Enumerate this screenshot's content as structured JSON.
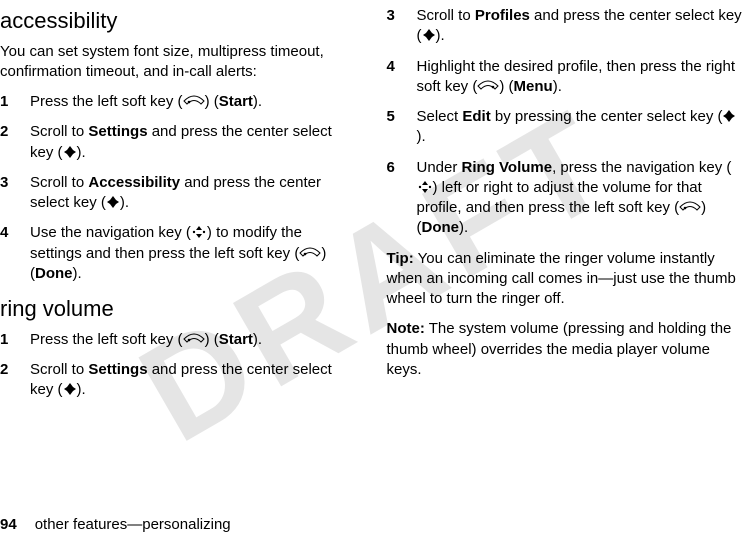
{
  "watermark_text": "DRAFT",
  "left": {
    "section1_title": "accessibility",
    "section1_intro": "You can set system font size, multipress timeout, confirmation timeout, and in-call alerts:",
    "s1_step1_pre": "Press the left soft key (",
    "s1_step1_post": ") (",
    "s1_step1_bold": "Start",
    "s1_step1_end": ").",
    "s1_step2_pre": "Scroll to ",
    "s1_step2_bold1": "Settings",
    "s1_step2_mid": " and press the center select key (",
    "s1_step2_end": ").",
    "s1_step3_pre": "Scroll to ",
    "s1_step3_bold1": "Accessibility",
    "s1_step3_mid": " and press the center select key (",
    "s1_step3_end": ").",
    "s1_step4_pre": "Use the navigation key (",
    "s1_step4_mid": ") to modify the settings and then press the left soft key (",
    "s1_step4_post": ") (",
    "s1_step4_bold": "Done",
    "s1_step4_end": ").",
    "section2_title": "ring volume",
    "s2_step1_pre": "Press the left soft key (",
    "s2_step1_post": ") (",
    "s2_step1_bold": "Start",
    "s2_step1_end": ").",
    "s2_step2_pre": "Scroll to ",
    "s2_step2_bold1": "Settings",
    "s2_step2_mid": " and press the center select key (",
    "s2_step2_end": ")."
  },
  "right": {
    "s3_pre": "Scroll to ",
    "s3_bold1": "Profiles",
    "s3_mid": " and press the center select key (",
    "s3_end": ").",
    "s4_pre": "Highlight the desired profile, then press the right soft key (",
    "s4_post": ") (",
    "s4_bold": "Menu",
    "s4_end": ").",
    "s5_pre": "Select ",
    "s5_bold1": "Edit",
    "s5_mid": " by pressing the center select key (",
    "s5_end": ").",
    "s6_pre": "Under ",
    "s6_bold1": "Ring Volume",
    "s6_mid1": ", press the navigation key (",
    "s6_mid2": ") left or right to adjust the volume for that profile, and then press the left soft key (",
    "s6_post": ") (",
    "s6_bold2": "Done",
    "s6_end": ").",
    "tip_label": "Tip:",
    "tip_text": " You can eliminate the ringer volume instantly when an incoming call comes in—just use the thumb wheel to turn the ringer off.",
    "note_label": "Note:",
    "note_text": " The system volume (pressing and holding the thumb wheel) overrides the media player volume keys."
  },
  "footer": {
    "page_num": "94",
    "section_path": "other features—personalizing"
  },
  "nums": {
    "n1": "1",
    "n2": "2",
    "n3": "3",
    "n4": "4",
    "n5": "5",
    "n6": "6"
  }
}
